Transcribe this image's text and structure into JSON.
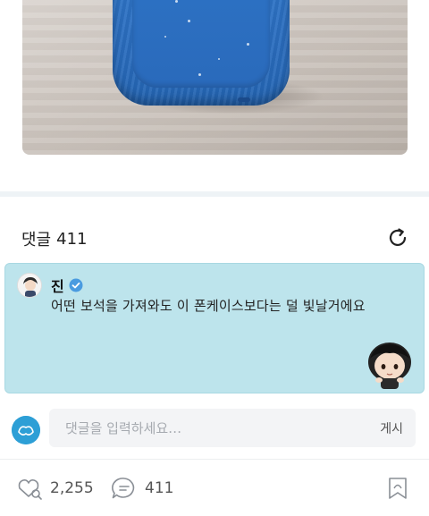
{
  "comments": {
    "label": "댓글",
    "count": "411"
  },
  "pinned_comment": {
    "author": "진",
    "text": "어떤 보석을 가져와도 이 폰케이스보다는 덜 빛날거에요"
  },
  "comment_input": {
    "placeholder": "댓글을 입력하세요…",
    "post_label": "게시"
  },
  "stats": {
    "likes": "2,255",
    "comments": "411"
  },
  "colors": {
    "pinned_bg": "#bde4ec",
    "verified": "#4a9be0",
    "case_blue": "#2a6cbd"
  },
  "icons": [
    "refresh-icon",
    "verified-icon",
    "like-icon",
    "comment-icon",
    "bookmark-icon"
  ]
}
